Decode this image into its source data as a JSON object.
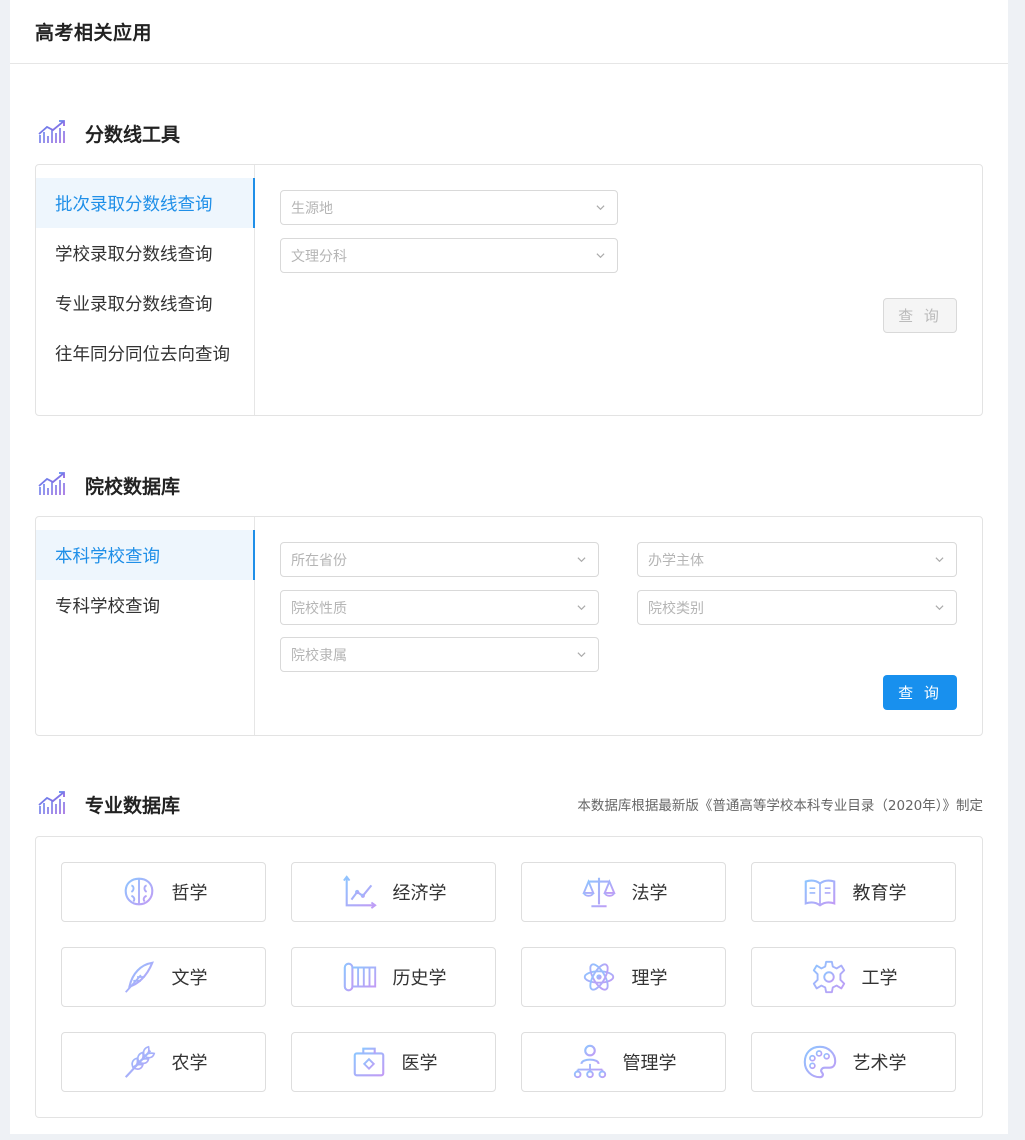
{
  "header": {
    "title": "高考相关应用"
  },
  "score_tool": {
    "title": "分数线工具",
    "menu": [
      {
        "label": "批次录取分数线查询",
        "active": true
      },
      {
        "label": "学校录取分数线查询",
        "active": false
      },
      {
        "label": "专业录取分数线查询",
        "active": false
      },
      {
        "label": "往年同分同位去向查询",
        "active": false
      }
    ],
    "selects": [
      "生源地",
      "文理分科"
    ],
    "query_label": "查 询"
  },
  "college_db": {
    "title": "院校数据库",
    "menu": [
      {
        "label": "本科学校查询",
        "active": true
      },
      {
        "label": "专科学校查询",
        "active": false
      }
    ],
    "selects": [
      "所在省份",
      "办学主体",
      "院校性质",
      "院校类别",
      "院校隶属"
    ],
    "query_label": "查 询"
  },
  "major_db": {
    "title": "专业数据库",
    "note": "本数据库根据最新版《普通高等学校本科专业目录（2020年）》制定",
    "majors": [
      {
        "label": "哲学",
        "icon": "brain-icon"
      },
      {
        "label": "经济学",
        "icon": "chart-icon"
      },
      {
        "label": "法学",
        "icon": "scale-icon"
      },
      {
        "label": "教育学",
        "icon": "book-icon"
      },
      {
        "label": "文学",
        "icon": "quill-icon"
      },
      {
        "label": "历史学",
        "icon": "scroll-icon"
      },
      {
        "label": "理学",
        "icon": "atom-icon"
      },
      {
        "label": "工学",
        "icon": "gear-icon"
      },
      {
        "label": "农学",
        "icon": "wheat-icon"
      },
      {
        "label": "医学",
        "icon": "medkit-icon"
      },
      {
        "label": "管理学",
        "icon": "org-icon"
      },
      {
        "label": "艺术学",
        "icon": "palette-icon"
      }
    ]
  },
  "colors": {
    "accent": "#1890ee",
    "icon_gradient_start": "#8ec5ff",
    "icon_gradient_end": "#c19bf5"
  }
}
